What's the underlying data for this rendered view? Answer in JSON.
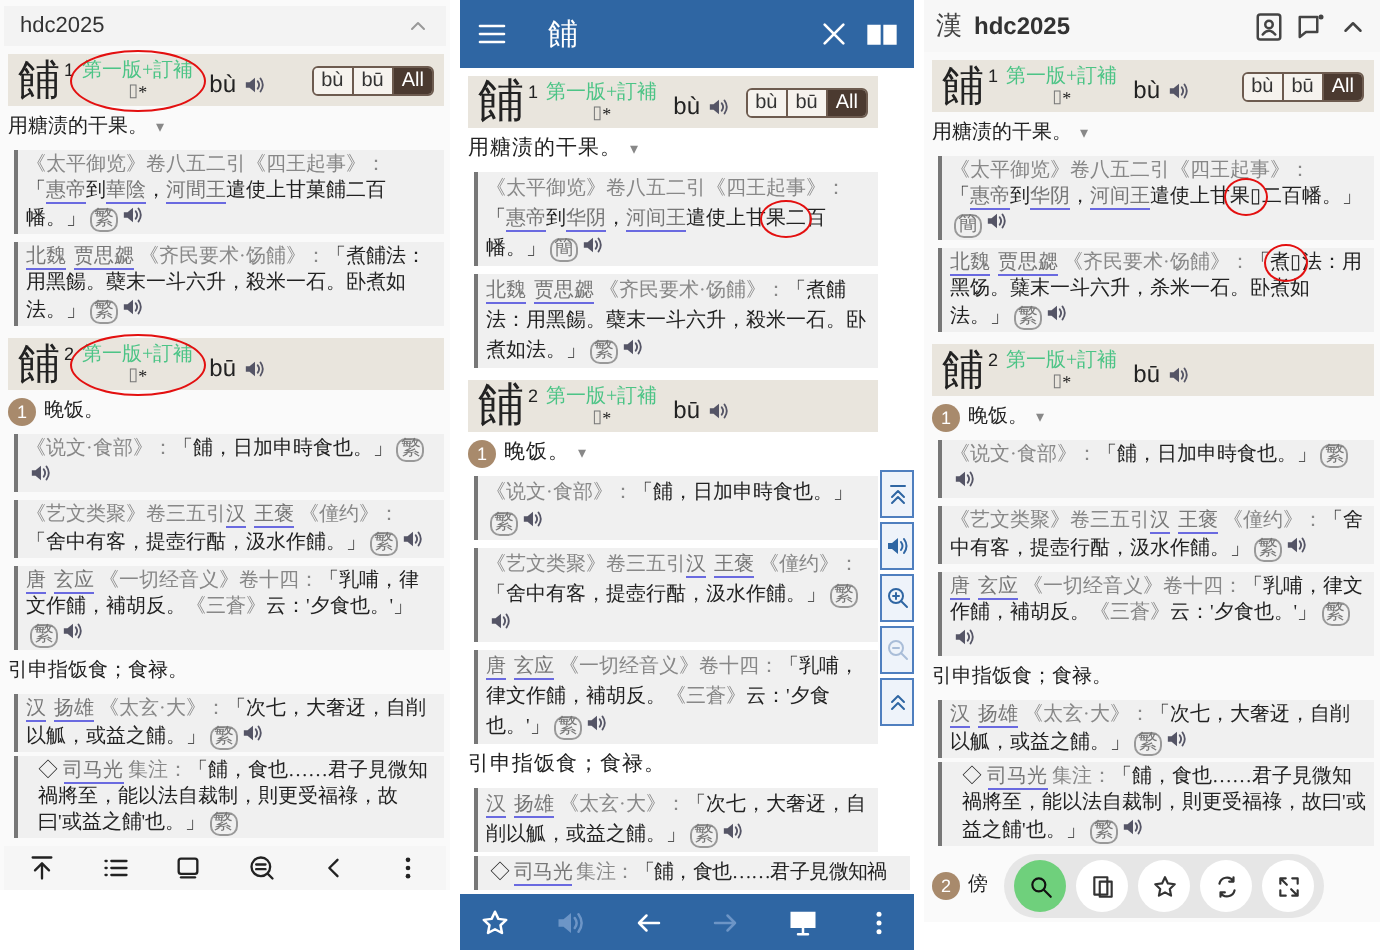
{
  "panels": [
    {
      "kind": "plain",
      "title": "hdc2025",
      "entries": [
        {
          "head": "餔",
          "sup": "1",
          "edition": "第一版+訂補",
          "glyph": "▯",
          "star": "*",
          "pinyin": "bù",
          "circled": true,
          "tones": [
            {
              "label": "bù",
              "selected": false
            },
            {
              "label": "bū",
              "selected": false
            },
            {
              "label": "All",
              "selected": true
            }
          ],
          "blocks": [
            {
              "kind": "def",
              "text": "用糖渍的干果。",
              "toggle": "▾"
            },
            {
              "kind": "quote",
              "badge": "繁",
              "audio": true,
              "segments": [
                {
                  "kind": "src",
                  "text": "《太平御览》卷八五二引《四王起事》："
                },
                {
                  "kind": "text",
                  "text": "「"
                },
                {
                  "kind": "link",
                  "text": "惠帝"
                },
                {
                  "kind": "text",
                  "text": "到"
                },
                {
                  "kind": "link",
                  "text": "華陰"
                },
                {
                  "kind": "text",
                  "text": "，"
                },
                {
                  "kind": "link",
                  "text": "河間王"
                },
                {
                  "kind": "text",
                  "text": "遣使上甘菓餔二百幡。」"
                }
              ]
            },
            {
              "kind": "quote",
              "badge": "繁",
              "audio": true,
              "segments": [
                {
                  "kind": "link",
                  "text": "北魏"
                },
                {
                  "kind": "link",
                  "text": "贾思勰"
                },
                {
                  "kind": "src",
                  "text": " 《齐民要术·饧餔》："
                },
                {
                  "kind": "text",
                  "text": "「煮餔法：用黑餳。蘗末一斗六升，殺米一石。卧煮如法。」"
                }
              ]
            }
          ]
        },
        {
          "head": "餔",
          "sup": "2",
          "edition": "第一版+訂補",
          "glyph": "▯",
          "star": "*",
          "pinyin": "bū",
          "circled": true,
          "blocks": [
            {
              "kind": "sense",
              "number": "1",
              "text": "晚饭。"
            },
            {
              "kind": "quote",
              "badge": "繁",
              "audio": true,
              "segments": [
                {
                  "kind": "src",
                  "text": "《说文·食部》："
                },
                {
                  "kind": "text",
                  "text": "「餔，日加申時食也。」"
                }
              ]
            },
            {
              "kind": "quote",
              "badge": "繁",
              "audio": true,
              "segments": [
                {
                  "kind": "src",
                  "text": "《艺文类聚》卷三五引"
                },
                {
                  "kind": "link",
                  "text": "汉"
                },
                {
                  "kind": "link",
                  "text": "王褒"
                },
                {
                  "kind": "src",
                  "text": " 《僮约》："
                },
                {
                  "kind": "text",
                  "text": "「舍中有客，提壺行酤，汲水作餔。」"
                }
              ]
            },
            {
              "kind": "quote",
              "badge": "繁",
              "audio": true,
              "segments": [
                {
                  "kind": "link",
                  "text": "唐"
                },
                {
                  "kind": "link",
                  "text": "玄应"
                },
                {
                  "kind": "src",
                  "text": " 《一切经音义》卷十四："
                },
                {
                  "kind": "text",
                  "text": "「乳哺，律文作餔，補胡反。"
                },
                {
                  "kind": "src",
                  "text": "《三蒼》"
                },
                {
                  "kind": "text",
                  "text": "云：'夕食也。'」"
                }
              ]
            },
            {
              "kind": "def",
              "text": "引申指饭食；食禄。"
            },
            {
              "kind": "quote",
              "badge": "繁",
              "audio": true,
              "segments": [
                {
                  "kind": "link",
                  "text": "汉"
                },
                {
                  "kind": "link",
                  "text": "扬雄"
                },
                {
                  "kind": "src",
                  "text": " 《太玄·大》："
                },
                {
                  "kind": "text",
                  "text": "「次七，大奢迓，自削以觚，或益之餔。」"
                }
              ]
            },
            {
              "kind": "subquote",
              "badge": "繁",
              "segments": [
                {
                  "kind": "text",
                  "text": "◇ "
                },
                {
                  "kind": "link",
                  "text": "司马光"
                },
                {
                  "kind": "src",
                  "text": " 集注："
                },
                {
                  "kind": "text",
                  "text": "「餔，食也……君子見微知禍將至，能以法自裁制，則更受福祿，故曰'或益之餔'也。」"
                }
              ]
            }
          ]
        }
      ]
    },
    {
      "kind": "appbar",
      "title": "餔",
      "side_tools": [
        {
          "disabled": false
        },
        {
          "disabled": false
        },
        {
          "disabled": false
        },
        {
          "disabled": true
        },
        {
          "disabled": false
        }
      ],
      "bottom_bar": [
        {
          "disabled": false
        },
        {
          "disabled": true
        },
        {
          "disabled": false
        },
        {
          "disabled": true
        },
        {
          "disabled": false
        },
        {
          "disabled": false
        }
      ],
      "entries": [
        {
          "head": "餔",
          "sup": "1",
          "edition": "第一版+訂補",
          "glyph": "▯",
          "star": "*",
          "pinyin": "bù",
          "tones": [
            {
              "label": "bù",
              "selected": false
            },
            {
              "label": "bū",
              "selected": false
            },
            {
              "label": "All",
              "selected": true
            }
          ],
          "blocks": [
            {
              "kind": "def",
              "text": "用糖渍的干果。",
              "toggle": "▾"
            },
            {
              "kind": "quote",
              "badge": "簡",
              "audio": true,
              "segments": [
                {
                  "kind": "src",
                  "text": "《太平御览》卷八五二引《四王起事》："
                },
                {
                  "kind": "text",
                  "text": "「"
                },
                {
                  "kind": "link",
                  "text": "惠帝"
                },
                {
                  "kind": "text",
                  "text": "到"
                },
                {
                  "kind": "link",
                  "text": "华阴"
                },
                {
                  "kind": "text",
                  "text": "，"
                },
                {
                  "kind": "link",
                  "text": "河间王"
                },
                {
                  "kind": "text",
                  "text": "遣使上甘"
                },
                {
                  "kind": "text",
                  "text": "果二",
                  "circled": true
                },
                {
                  "kind": "text",
                  "text": "百幡。」"
                }
              ]
            },
            {
              "kind": "quote",
              "badge": "繁",
              "audio": true,
              "segments": [
                {
                  "kind": "link",
                  "text": "北魏"
                },
                {
                  "kind": "link",
                  "text": "贾思勰"
                },
                {
                  "kind": "src",
                  "text": " 《齐民要术·饧餔》："
                },
                {
                  "kind": "text",
                  "text": "「煮餔法：用黑餳。蘗末一斗六升，殺米一石。卧煮如法。」"
                }
              ]
            }
          ]
        },
        {
          "head": "餔",
          "sup": "2",
          "edition": "第一版+訂補",
          "glyph": "▯",
          "star": "*",
          "pinyin": "bū",
          "blocks": [
            {
              "kind": "sense",
              "number": "1",
              "text": "晚饭。",
              "toggle": "▾"
            },
            {
              "kind": "quote",
              "badge": "繁",
              "audio": true,
              "segments": [
                {
                  "kind": "src",
                  "text": "《说文·食部》："
                },
                {
                  "kind": "text",
                  "text": "「餔，日加申時食也。」"
                }
              ]
            },
            {
              "kind": "quote",
              "badge": "繁",
              "audio": true,
              "segments": [
                {
                  "kind": "src",
                  "text": "《艺文类聚》卷三五引"
                },
                {
                  "kind": "link",
                  "text": "汉"
                },
                {
                  "kind": "link",
                  "text": "王褒"
                },
                {
                  "kind": "src",
                  "text": " 《僮约》："
                },
                {
                  "kind": "text",
                  "text": "「舍中有客，提壺行酤，汲水作餔。」"
                }
              ]
            },
            {
              "kind": "quote",
              "badge": "繁",
              "audio": true,
              "segments": [
                {
                  "kind": "link",
                  "text": "唐"
                },
                {
                  "kind": "link",
                  "text": "玄应"
                },
                {
                  "kind": "src",
                  "text": " 《一切经音义》卷十四："
                },
                {
                  "kind": "text",
                  "text": "「乳哺，律文作餔，補胡反。"
                },
                {
                  "kind": "src",
                  "text": "《三蒼》"
                },
                {
                  "kind": "text",
                  "text": "云：'夕食也。'」"
                }
              ]
            },
            {
              "kind": "def",
              "text": "引申指饭食；食禄。"
            },
            {
              "kind": "quote",
              "badge": "繁",
              "audio": true,
              "segments": [
                {
                  "kind": "link",
                  "text": "汉"
                },
                {
                  "kind": "link",
                  "text": "扬雄"
                },
                {
                  "kind": "src",
                  "text": " 《太玄·大》："
                },
                {
                  "kind": "text",
                  "text": "「次七，大奢迓，自削以觚，或益之餔。」"
                }
              ]
            },
            {
              "kind": "subquote",
              "segments": [
                {
                  "kind": "text",
                  "text": "◇ "
                },
                {
                  "kind": "link",
                  "text": "司马光"
                },
                {
                  "kind": "src",
                  "text": " 集注："
                },
                {
                  "kind": "text",
                  "text": "「餔，食也……君子見微知禍"
                }
              ]
            }
          ]
        }
      ]
    },
    {
      "kind": "brand",
      "logo": "漢",
      "title": "hdc2025",
      "entries": [
        {
          "head": "餔",
          "sup": "1",
          "edition": "第一版+訂補",
          "glyph": "▯",
          "star": "*",
          "pinyin": "bù",
          "tones": [
            {
              "label": "bù",
              "selected": false
            },
            {
              "label": "bū",
              "selected": false
            },
            {
              "label": "All",
              "selected": true
            }
          ],
          "blocks": [
            {
              "kind": "def",
              "text": "用糖渍的干果。",
              "toggle": "▾"
            },
            {
              "kind": "quote",
              "badge": "簡",
              "audio": true,
              "segments": [
                {
                  "kind": "src",
                  "text": "《太平御览》卷八五二引《四王起事》："
                },
                {
                  "kind": "text",
                  "text": "「"
                },
                {
                  "kind": "link",
                  "text": "惠帝"
                },
                {
                  "kind": "text",
                  "text": "到"
                },
                {
                  "kind": "link",
                  "text": "华阴"
                },
                {
                  "kind": "text",
                  "text": "，"
                },
                {
                  "kind": "link",
                  "text": "河间王"
                },
                {
                  "kind": "text",
                  "text": "遣使上甘"
                },
                {
                  "kind": "text",
                  "text": "果▯",
                  "circled": true
                },
                {
                  "kind": "text",
                  "text": "二百幡。」"
                }
              ]
            },
            {
              "kind": "quote",
              "badge": "繁",
              "audio": true,
              "segments": [
                {
                  "kind": "link",
                  "text": "北魏"
                },
                {
                  "kind": "link",
                  "text": "贾思勰"
                },
                {
                  "kind": "src",
                  "text": " 《齐民要术·饧餔》："
                },
                {
                  "kind": "text",
                  "text": "「"
                },
                {
                  "kind": "text",
                  "text": "煮▯",
                  "circled": true
                },
                {
                  "kind": "text",
                  "text": "法：用黑饧。蘖末一斗六升，杀米一石。卧煮如法。」"
                }
              ]
            }
          ]
        },
        {
          "head": "餔",
          "sup": "2",
          "edition": "第一版+訂補",
          "glyph": "▯",
          "star": "*",
          "pinyin": "bū",
          "blocks": [
            {
              "kind": "sense",
              "number": "1",
              "text": "晚饭。",
              "toggle": "▾"
            },
            {
              "kind": "quote",
              "badge": "繁",
              "audio": true,
              "segments": [
                {
                  "kind": "src",
                  "text": "《说文·食部》："
                },
                {
                  "kind": "text",
                  "text": "「餔，日加申時食也。」"
                }
              ]
            },
            {
              "kind": "quote",
              "badge": "繁",
              "audio": true,
              "segments": [
                {
                  "kind": "src",
                  "text": "《艺文类聚》卷三五引"
                },
                {
                  "kind": "link",
                  "text": "汉"
                },
                {
                  "kind": "link",
                  "text": "王褒"
                },
                {
                  "kind": "src",
                  "text": " 《僮约》："
                },
                {
                  "kind": "text",
                  "text": "「舍中有客，提壺行酤，汲水作餔。」"
                }
              ]
            },
            {
              "kind": "quote",
              "badge": "繁",
              "audio": true,
              "segments": [
                {
                  "kind": "link",
                  "text": "唐"
                },
                {
                  "kind": "link",
                  "text": "玄应"
                },
                {
                  "kind": "src",
                  "text": " 《一切经音义》卷十四："
                },
                {
                  "kind": "text",
                  "text": "「乳哺，律文作餔，補胡反。"
                },
                {
                  "kind": "src",
                  "text": "《三蒼》"
                },
                {
                  "kind": "text",
                  "text": "云：'夕食也。'」"
                }
              ]
            },
            {
              "kind": "def",
              "text": "引申指饭食；食禄。"
            },
            {
              "kind": "quote",
              "badge": "繁",
              "audio": true,
              "segments": [
                {
                  "kind": "link",
                  "text": "汉"
                },
                {
                  "kind": "link",
                  "text": "扬雄"
                },
                {
                  "kind": "src",
                  "text": " 《太玄·大》："
                },
                {
                  "kind": "text",
                  "text": "「次七，大奢迓，自削以觚，或益之餔。」"
                }
              ]
            },
            {
              "kind": "subquote",
              "badge": "繁",
              "audio": true,
              "segments": [
                {
                  "kind": "text",
                  "text": "◇ "
                },
                {
                  "kind": "link",
                  "text": "司马光"
                },
                {
                  "kind": "src",
                  "text": " 集注："
                },
                {
                  "kind": "text",
                  "text": "「餔，食也……君子見微知禍將至，能以法自裁制，則更受福祿，故曰'或益之餔'也。」"
                }
              ]
            },
            {
              "kind": "sense",
              "number": "2",
              "text": "傍",
              "toolbar": true
            }
          ]
        }
      ]
    }
  ]
}
